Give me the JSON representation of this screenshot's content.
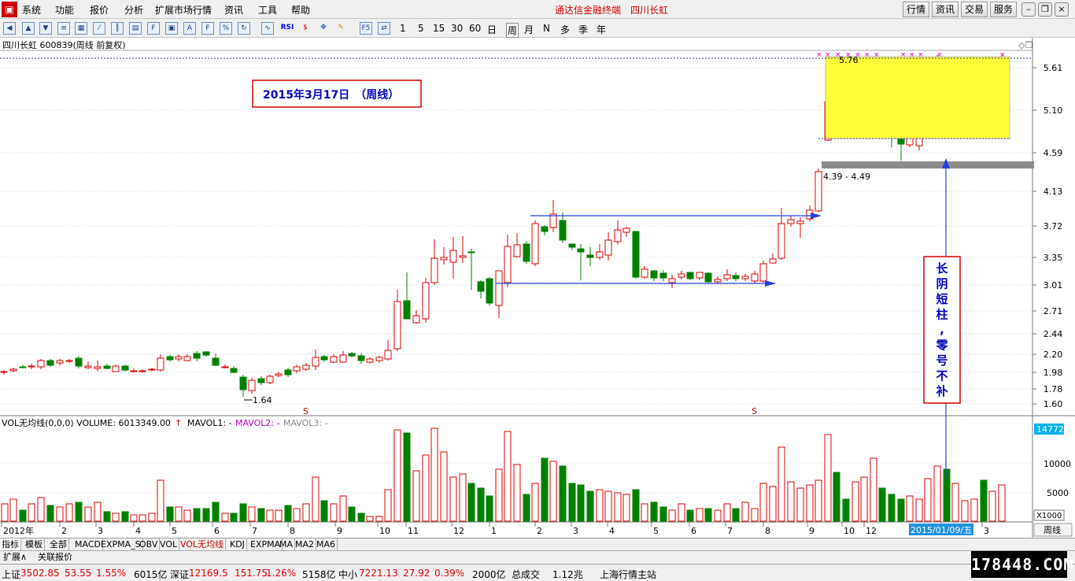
{
  "menu": [
    "系统",
    "功能",
    "报价",
    "分析",
    "扩展市场行情",
    "资讯",
    "工具",
    "帮助"
  ],
  "center_title": "通达信金融终端　四川长虹",
  "top_buttons": [
    "行情",
    "资讯",
    "交易",
    "服务"
  ],
  "toolbar_text": [
    "1",
    "5",
    "15",
    "30",
    "60",
    "日",
    "周",
    "月",
    "N",
    "多",
    "季",
    "年"
  ],
  "chart": {
    "title": "四川长虹 600839(周线 前复权)",
    "annotation_box": "2015年3月17日　（周线）",
    "high_label": "5.76",
    "low_label": "1.64",
    "range_label": "4.39 - 4.49",
    "note_vertical": [
      "长",
      "阴",
      "短",
      "柱",
      ",",
      "零",
      "号",
      "不",
      "补"
    ],
    "y_ticks": [
      "5.61",
      "5.10",
      "4.59",
      "4.13",
      "3.72",
      "3.35",
      "3.01",
      "2.71",
      "2.44",
      "2.20",
      "1.98",
      "1.78",
      "1.60"
    ],
    "x_labels": [
      "2012年",
      "2",
      "3",
      "4",
      "5",
      "6",
      "7",
      "8",
      "9",
      "10",
      "11",
      "12",
      "1",
      "2",
      "3",
      "4",
      "5",
      "6",
      "7",
      "8",
      "9",
      "10",
      "12",
      "1",
      "3"
    ],
    "date_badge": "2015/01/09/五",
    "period_button": "周线",
    "s_markers": [
      "S",
      "S"
    ]
  },
  "volume": {
    "legend_a": "VOL无均线(0,0,0)  VOLUME: 6013349.00",
    "arrow": "↑",
    "mavol1": "MAVOL1: -",
    "mavol2": "MAVOL2: -",
    "mavol3": "MAVOL3: -",
    "current_badge": "14772",
    "y_ticks": [
      "10000",
      "5000"
    ],
    "unit": "X1000"
  },
  "tabs": [
    "指标",
    "模板",
    "全部",
    "MACD",
    "EXPMA_S",
    "OBV",
    "VOL",
    "VOL无均线",
    "KDJ",
    "EXPMA",
    "MA",
    "MA2",
    "MA6"
  ],
  "ext": [
    "扩展∧",
    "关联报价"
  ],
  "status": {
    "sh_label": "上证",
    "sh_val": "3502.85",
    "sh_chg": "53.55",
    "sh_pct": "1.55%",
    "sh_amt": "6015亿",
    "sz_label": "深证",
    "sz_val": "12169.5",
    "sz_chg": "151.75",
    "sz_pct": "1.26%",
    "sz_amt": "5158亿",
    "zx_label": "中小",
    "zx_val": "7221.13",
    "zx_chg": "27.92",
    "zx_pct": "0.39%",
    "zx_amt": "2000亿",
    "total_label": "总成交",
    "total_val": "1.12兆",
    "station": "上海行情主站"
  },
  "watermark": "178448.COM"
}
